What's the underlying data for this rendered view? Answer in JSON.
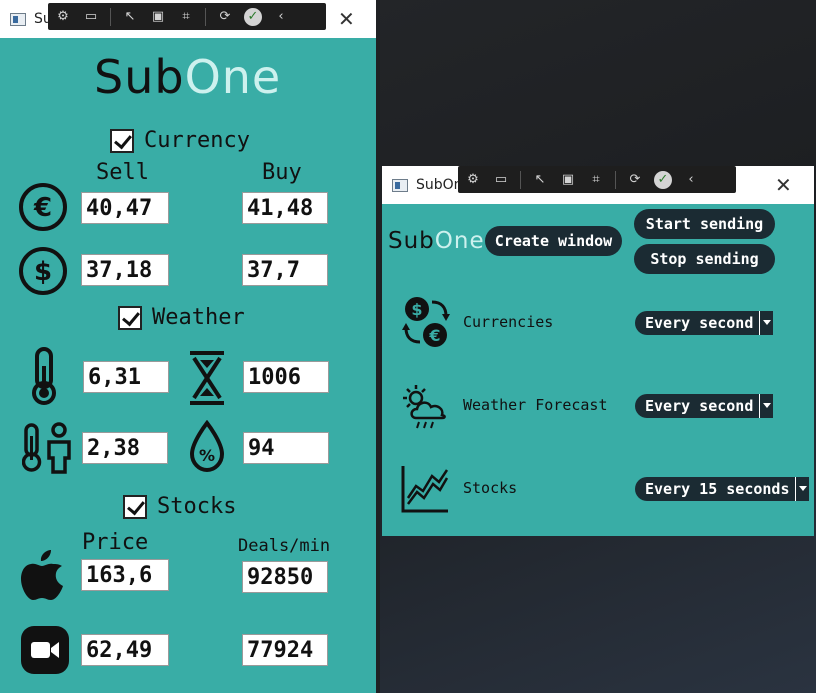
{
  "left_window": {
    "title": "Sub",
    "logo": {
      "part1": "Sub",
      "part2": "One"
    },
    "currency": {
      "label": "Currency",
      "checked": true,
      "col_sell": "Sell",
      "col_buy": "Buy",
      "rows": [
        {
          "icon": "euro-icon",
          "sell": "40,47",
          "buy": "41,48"
        },
        {
          "icon": "dollar-icon",
          "sell": "37,18",
          "buy": "37,7"
        }
      ]
    },
    "weather": {
      "label": "Weather",
      "checked": true,
      "temperature": "6,31",
      "pressure": "1006",
      "feels_like": "2,38",
      "humidity": "94"
    },
    "stocks": {
      "label": "Stocks",
      "checked": true,
      "col_price": "Price",
      "col_deals": "Deals/min",
      "rows": [
        {
          "icon": "apple-icon",
          "price": "163,6",
          "deals": "92850"
        },
        {
          "icon": "zoom-icon",
          "price": "62,49",
          "deals": "77924"
        }
      ]
    }
  },
  "right_window": {
    "title": "SubOn",
    "logo": {
      "part1": "Sub",
      "part2": "One"
    },
    "create_window": "Create window",
    "start_sending": "Start sending",
    "stop_sending": "Stop sending",
    "rows": [
      {
        "icon": "currency-exchange-icon",
        "label": "Currencies",
        "interval": "Every second"
      },
      {
        "icon": "weather-icon",
        "label": "Weather Forecast",
        "interval": "Every second"
      },
      {
        "icon": "stocks-chart-icon",
        "label": "Stocks",
        "interval": "Every 15 seconds"
      }
    ]
  },
  "colors": {
    "window_bg": "#39ada6",
    "button_bg": "#1b2b33",
    "logo_accent": "#cdf1ee"
  }
}
